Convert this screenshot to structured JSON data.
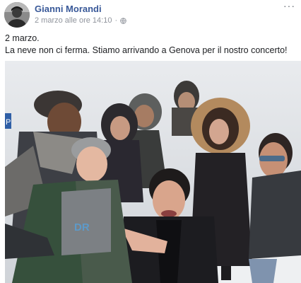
{
  "post": {
    "author_name": "Gianni Morandi",
    "timestamp": "2 marzo alle ore 14:10",
    "separator": "·",
    "privacy_icon": "globe-icon",
    "more_icon": "ellipsis-icon",
    "more_label": "···",
    "text_line_1": "2 marzo.",
    "text_line_2": "La neve non ci ferma. Stiamo arrivando a Genova per il nostro concerto!",
    "photo": {
      "description_icon": "group-selfie-photo",
      "sign_letter": "P",
      "hoodie_text": "DR"
    }
  },
  "colors": {
    "author_link": "#385898",
    "meta_gray": "#90949c",
    "text": "#1c1e21"
  }
}
